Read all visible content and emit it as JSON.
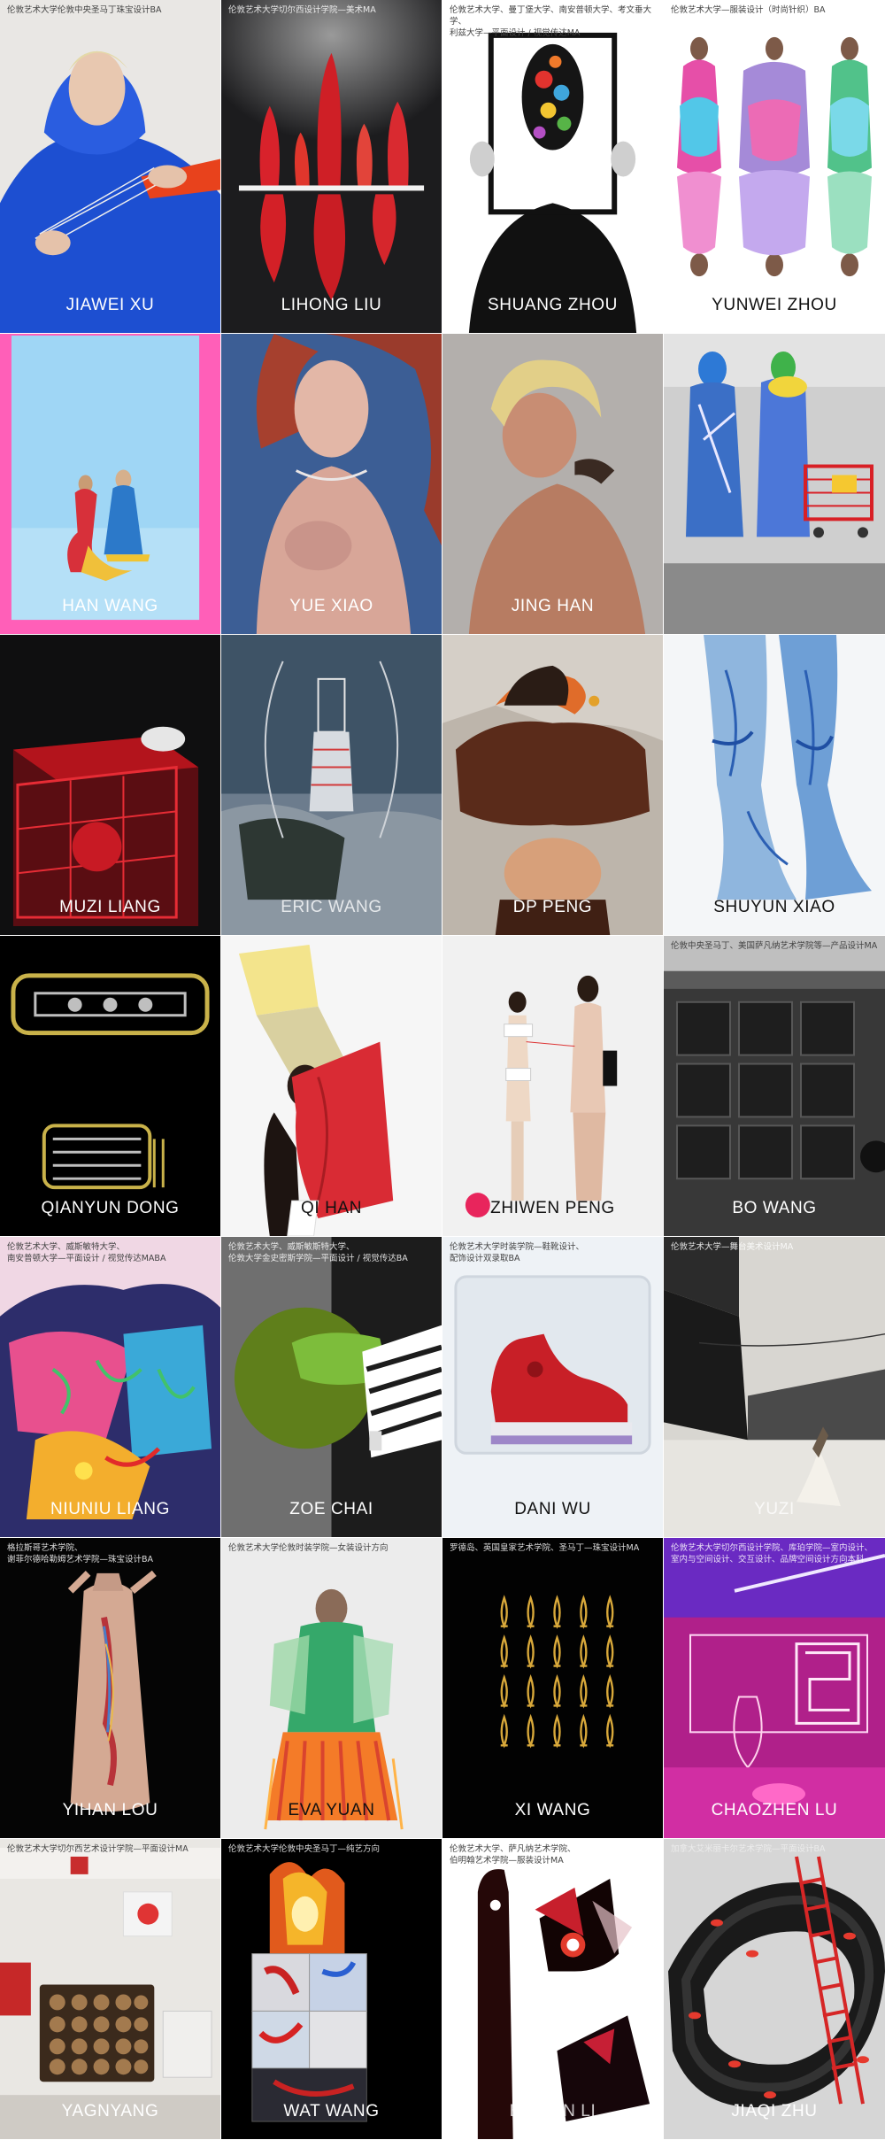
{
  "gallery": {
    "tiles": [
      {
        "name": "JIAWEI XU",
        "caption": "伦敦艺术大学伦敦中央圣马丁珠宝设计BA"
      },
      {
        "name": "LIHONG LIU",
        "caption": "伦敦艺术大学切尔西设计学院—美术MA"
      },
      {
        "name": "SHUANG ZHOU",
        "caption": "伦敦艺术大学、曼丁堡大学、南安普顿大学、考文垂大学、\n利兹大学—平面设计 / 视觉传达MA"
      },
      {
        "name": "YUNWEI ZHOU",
        "caption": "伦敦艺术大学—服装设计（时尚针织）BA"
      },
      {
        "name": "HAN WANG",
        "caption": ""
      },
      {
        "name": "YUE XIAO",
        "caption": ""
      },
      {
        "name": "JING HAN",
        "caption": ""
      },
      {
        "name": "",
        "caption": ""
      },
      {
        "name": "MUZI LIANG",
        "caption": ""
      },
      {
        "name": "ERIC WANG",
        "caption": ""
      },
      {
        "name": "DP PENG",
        "caption": ""
      },
      {
        "name": "SHUYUN XIAO",
        "caption": ""
      },
      {
        "name": "QIANYUN DONG",
        "caption": ""
      },
      {
        "name": "QI HAN",
        "caption": ""
      },
      {
        "name": "ZHIWEN PENG",
        "caption": ""
      },
      {
        "name": "BO WANG",
        "caption": "伦敦中央圣马丁、美国萨凡纳艺术学院等—产品设计MA"
      },
      {
        "name": "NIUNIU LIANG",
        "caption": "伦敦艺术大学、威斯敏特大学、\n南安普顿大学—平面设计 / 视觉传达MABA"
      },
      {
        "name": "ZOE CHAI",
        "caption": "伦敦艺术大学、威斯敏斯特大学、\n伦敦大学金史密斯学院—平面设计 / 视觉传达BA"
      },
      {
        "name": "DANI WU",
        "caption": "伦敦艺术大学时装学院—鞋靴设计、\n配饰设计双录取BA"
      },
      {
        "name": "YUZI",
        "caption": "伦敦艺术大学—舞台美术设计MA"
      },
      {
        "name": "YIHAN LOU",
        "caption": "格拉斯哥艺术学院、\n谢菲尔德哈勒姆艺术学院—珠宝设计BA"
      },
      {
        "name": "EVA YUAN",
        "caption": "伦敦艺术大学伦敦时装学院—女装设计方向"
      },
      {
        "name": "XI WANG",
        "caption": "罗德岛、英国皇家艺术学院、圣马丁—珠宝设计MA"
      },
      {
        "name": "CHAOZHEN LU",
        "caption": "伦敦艺术大学切尔西设计学院、库珀学院—室内设计、\n室内与空间设计、交互设计、品牌空间设计方向本科"
      },
      {
        "name": "YAGNYANG",
        "caption": "伦敦艺术大学切尔西艺术设计学院—平面设计MA"
      },
      {
        "name": "WAT WANG",
        "caption": "伦敦艺术大学伦敦中央圣马丁—纯艺方向"
      },
      {
        "name": "BOWEN LI",
        "caption": "伦敦艺术大学、萨凡纳艺术学院、\n伯明翰艺术学院—服装设计MA"
      },
      {
        "name": "JIAQI ZHU",
        "caption": "加拿大艾米丽卡尔艺术学院—平面设计BA"
      }
    ]
  }
}
